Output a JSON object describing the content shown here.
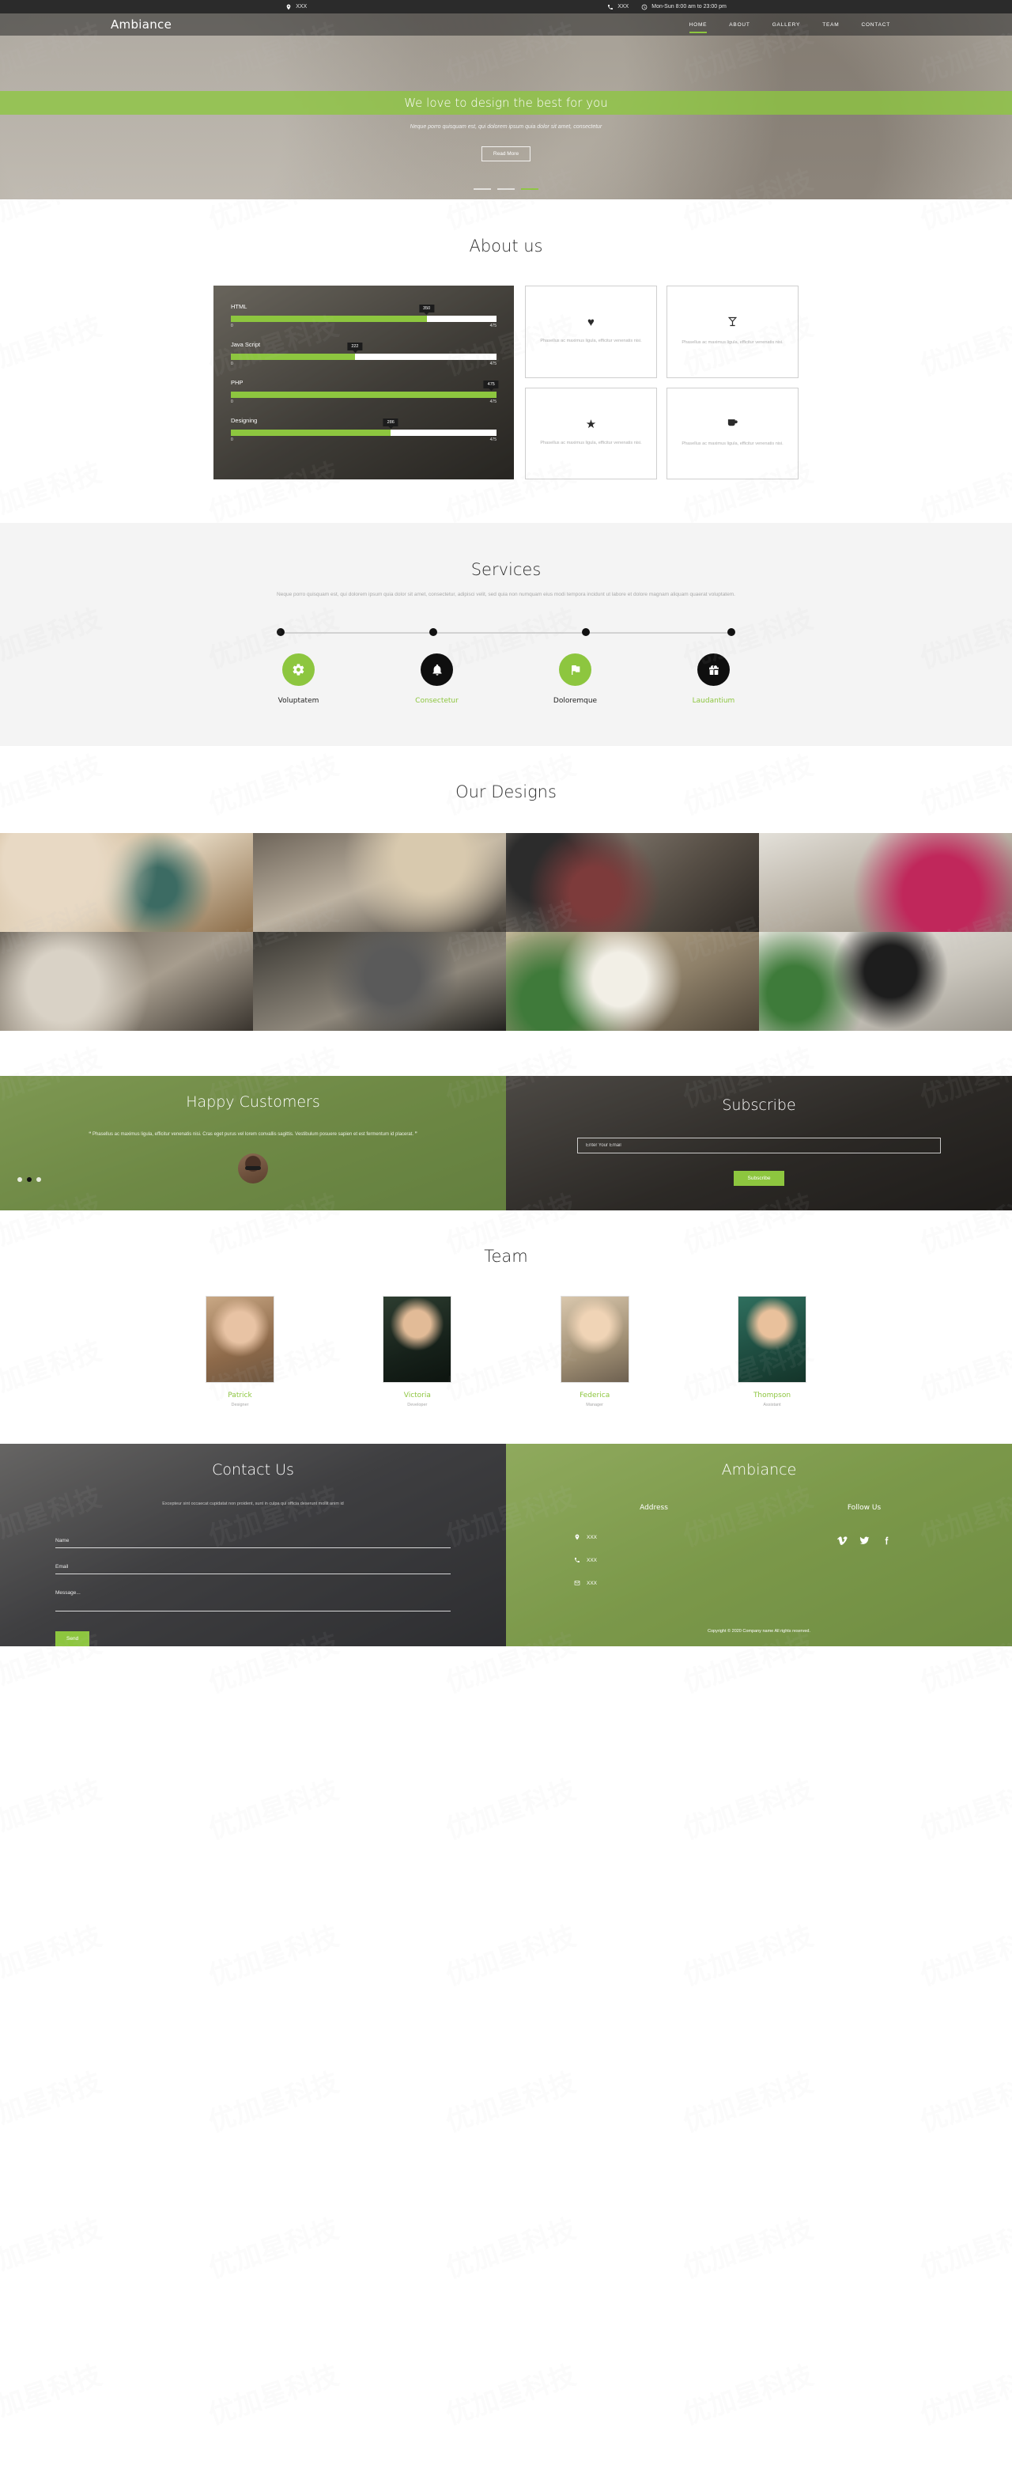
{
  "topbar": {
    "location_icon": "map-pin-icon",
    "location": "XXX",
    "phone_icon": "phone-icon",
    "phone": "XXX",
    "clock_icon": "clock-icon",
    "hours": "Mon-Sun 8:00 am to 23:00 pm"
  },
  "header": {
    "logo": "Ambiance",
    "nav": [
      {
        "label": "HOME",
        "active": true
      },
      {
        "label": "ABOUT",
        "active": false
      },
      {
        "label": "GALLERY",
        "active": false
      },
      {
        "label": "TEAM",
        "active": false
      },
      {
        "label": "CONTACT",
        "active": false
      }
    ]
  },
  "hero": {
    "title": "We love to design the best for you",
    "subtitle": "Neque porro quisquam est, qui dolorem ipsum quia dolor sit amet, consectetur",
    "button": "Read More",
    "slides": 3,
    "active_slide": 3
  },
  "about": {
    "title": "About us",
    "skills": [
      {
        "name": "HTML",
        "value": 350,
        "max": 475,
        "min_label": "0",
        "max_label": "475"
      },
      {
        "name": "Java Script",
        "value": 222,
        "max": 475,
        "min_label": "0",
        "max_label": "475"
      },
      {
        "name": "PHP",
        "value": 475,
        "max": 475,
        "min_label": "0",
        "max_label": "475"
      },
      {
        "name": "Designing",
        "value": 286,
        "max": 475,
        "min_label": "0",
        "max_label": "475"
      }
    ],
    "boxes": [
      {
        "icon": "heart-icon",
        "glyph": "♥",
        "text": "Phasellus ac maximus ligula, efficitur venenatis nisi."
      },
      {
        "icon": "cocktail-icon",
        "glyph": "🍸",
        "text": "Phasellus ac maximus ligula, efficitur venenatis nisi."
      },
      {
        "icon": "star-icon",
        "glyph": "★",
        "text": "Phasellus ac maximus ligula, efficitur venenatis nisi."
      },
      {
        "icon": "coffee-icon",
        "glyph": "☕",
        "text": "Phasellus ac maximus ligula, efficitur venenatis nisi."
      }
    ]
  },
  "services": {
    "title": "Services",
    "description": "Neque porro quisquam est, qui dolorem ipsum quia dolor sit amet, consectetur, adipisci velit, sed quia non numquam eius modi tempora incidunt ut labore et dolore magnam aliquam quaerat voluptatem.",
    "items": [
      {
        "label": "Voluptatem",
        "icon": "gear-icon",
        "glyph": "⚙",
        "circle": "green",
        "label_color": "dark"
      },
      {
        "label": "Consectetur",
        "icon": "bell-icon",
        "glyph": "🔔",
        "circle": "black",
        "label_color": "green"
      },
      {
        "label": "Doloremque",
        "icon": "flag-icon",
        "glyph": "⚑",
        "circle": "green",
        "label_color": "dark"
      },
      {
        "label": "Laudantium",
        "icon": "gift-icon",
        "glyph": "🎁",
        "circle": "black",
        "label_color": "green"
      }
    ]
  },
  "designs": {
    "title": "Our Designs",
    "tiles": [
      "design-bathroom-vanity",
      "design-modern-bedroom",
      "design-living-room-piano",
      "design-white-lounge-pink-sofa",
      "design-bedroom-shelves",
      "design-dark-tv-room",
      "design-dining-table",
      "design-entertainment-unit"
    ]
  },
  "happy": {
    "title": "Happy Customers",
    "quote_open": "“",
    "quote": "Phasellus ac maximus ligula, efficitur venenatis nisi. Cras eget purus vel lorem convallis sagittis. Vestibulum posuere sapien et est fermentum id placerat.",
    "quote_close": "”",
    "avatar": "customer-avatar",
    "dots": 3,
    "active_dot": 2
  },
  "subscribe": {
    "title": "Subscribe",
    "placeholder": "Enter Your Email",
    "value": "",
    "button": "Subscribe"
  },
  "team": {
    "title": "Team",
    "members": [
      {
        "name": "Patrick",
        "role": "Designer",
        "photo": "team-photo-patrick"
      },
      {
        "name": "Victoria",
        "role": "Developer",
        "photo": "team-photo-victoria"
      },
      {
        "name": "Federica",
        "role": "Manager",
        "photo": "team-photo-federica"
      },
      {
        "name": "Thompson",
        "role": "Assistant",
        "photo": "team-photo-thompson"
      }
    ]
  },
  "contact": {
    "title": "Contact Us",
    "description": "Excepteur sint occaecat cupidatat non proident, sunt in culpa qui officia deserunt mollit anim id",
    "name_placeholder": "Name",
    "email_placeholder": "Email",
    "message_placeholder": "Message...",
    "button": "Send"
  },
  "footer": {
    "brand": "Ambiance",
    "address_heading": "Address",
    "follow_heading": "Follow Us",
    "address_rows": [
      {
        "icon": "map-pin-icon",
        "text": "XXX"
      },
      {
        "icon": "phone-icon",
        "text": "XXX"
      },
      {
        "icon": "mail-icon",
        "text": "XXX"
      }
    ],
    "socials": [
      {
        "icon": "vimeo-icon",
        "glyph": "v"
      },
      {
        "icon": "twitter-icon",
        "glyph": "𝒕"
      },
      {
        "icon": "facebook-icon",
        "glyph": "f"
      }
    ],
    "copyright": "Copyright © 2020 Company name All rights reserved."
  },
  "theme": {
    "accent": "#8dc63f",
    "dark": "#111111",
    "topbar": "#2b2b2b"
  }
}
